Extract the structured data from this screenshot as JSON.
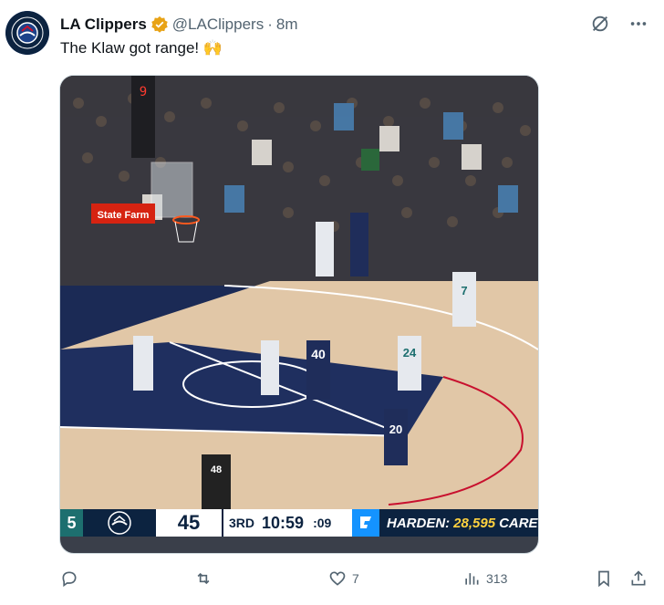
{
  "author": {
    "display_name": "LA Clippers",
    "handle": "@LAClippers",
    "separator": "·",
    "time_ago": "8m",
    "verified_color": "#e8a317",
    "avatar_text": "LOS ANGELES CLIPPERS"
  },
  "tweet": {
    "text": "The Klaw got range!",
    "emoji": "🙌"
  },
  "scoreboard": {
    "left_score_fragment": "5",
    "clippers_score": "45",
    "quarter": "3RD",
    "game_clock": "10:59",
    "shot_clock": ":09",
    "ticker_prefix": "HARDEN:",
    "ticker_number": "28,595",
    "ticker_suffix": "CAREER POIN"
  },
  "court": {
    "banner_left": "State Farm",
    "jersey_40": "40",
    "jersey_20": "20",
    "jersey_24": "24",
    "jersey_7": "7",
    "referee_number": "48"
  },
  "actions": {
    "reply_count": "",
    "retweet_count": "",
    "like_count": "7",
    "view_count": "313"
  },
  "colors": {
    "clippers_navy": "#0c2340",
    "accent_blue": "#1d9bf0",
    "muted_text": "#536471"
  }
}
